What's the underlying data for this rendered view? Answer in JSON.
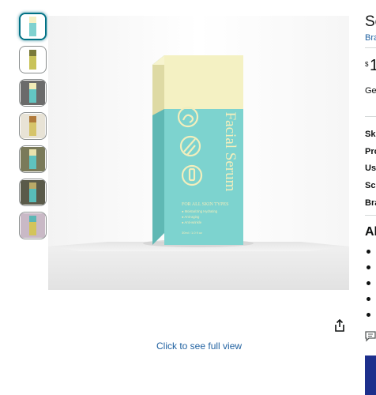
{
  "gallery": {
    "thumbnails": [
      {
        "label": "thumbnail-1",
        "active": true,
        "bg": "#ffffff",
        "box": "#7fd1cf",
        "cap": "#f5f0c4"
      },
      {
        "label": "thumbnail-2",
        "active": false,
        "bg": "#ffffff",
        "box": "#c9c35a",
        "cap": "#7a7a3a"
      },
      {
        "label": "thumbnail-3",
        "active": false,
        "bg": "#6b6b6b",
        "box": "#63c6c3",
        "cap": "#f2ecb8"
      },
      {
        "label": "thumbnail-4",
        "active": false,
        "bg": "#e8e3d6",
        "box": "#d6c46a",
        "cap": "#b07a3a"
      },
      {
        "label": "thumbnail-5",
        "active": false,
        "bg": "#7a7a5a",
        "box": "#5fc2bf",
        "cap": "#e9e2ad"
      },
      {
        "label": "thumbnail-6",
        "active": false,
        "bg": "#5a5a4a",
        "box": "#58bdb9",
        "cap": "#b9a968"
      },
      {
        "label": "thumbnail-7",
        "active": false,
        "bg": "#c9b9c6",
        "box": "#d3c45b",
        "cap": "#5bb7b5"
      }
    ],
    "product_box": {
      "title": "Facial Serum",
      "subtitle": "FOR ALL SKIN TYPES",
      "lines": [
        "● Moisturizing Hydrating",
        "● Anti-aging",
        "● Anti-wrinkle"
      ],
      "volume": "30ml / 1.0 fl oz",
      "box_color": "#7dd3cf",
      "cap_color": "#f4f1c3",
      "ink_color": "#f2eebd"
    },
    "full_view_label": "Click to see full view"
  },
  "product": {
    "title_fragment": "Se",
    "brand_fragment": "Bra",
    "currency": "$",
    "price_fragment": "1",
    "delivery_fragment": "Ge",
    "specs": [
      "Sk",
      "Pro",
      "Us",
      "Sc",
      "Bra"
    ],
    "about_fragment": "Ab"
  }
}
